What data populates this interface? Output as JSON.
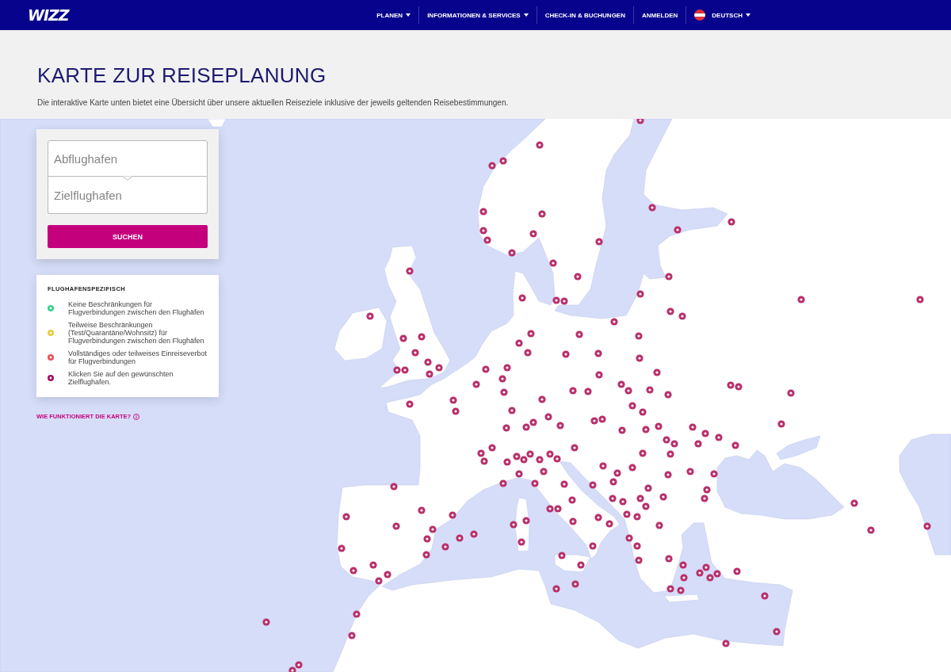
{
  "header": {
    "logo": "WIZZ",
    "nav": [
      {
        "label": "PLANEN",
        "dropdown": true
      },
      {
        "label": "INFORMATIONEN & SERVICES",
        "dropdown": true
      },
      {
        "label": "CHECK-IN & BUCHUNGEN",
        "dropdown": false
      },
      {
        "label": "ANMELDEN",
        "dropdown": false
      }
    ],
    "language": {
      "label": "DEUTSCH",
      "dropdown": true
    }
  },
  "intro": {
    "title": "KARTE ZUR REISEPLANUNG",
    "description": "Die interaktive Karte unten bietet eine Übersicht über unsere aktuellen Reiseziele inklusive der jeweils geltenden Reisebestimmungen."
  },
  "search": {
    "origin": {
      "placeholder": "Abflughafen"
    },
    "destination": {
      "placeholder": "Zielflughafen"
    },
    "button": "SUCHEN"
  },
  "legend": {
    "title": "FLUGHAFENSPEZIFISCH",
    "items": [
      {
        "text": "Keine Beschränkungen für Flugverbindungen zwischen den Flughäfen",
        "color": "#3ccf8e"
      },
      {
        "text": "Teilweise Beschränkungen (Test/Quarantäne/Wohnsitz) für Flugverbindungen zwischen den Flughäfen",
        "color": "#eccc3c"
      },
      {
        "text": "Vollständiges oder teilweises Einreiseverbot für Flugverbindungen",
        "color": "#e9505a"
      },
      {
        "text": "Klicken Sie auf den gewünschten Zielflughafen.",
        "color": "#a3105f"
      }
    ]
  },
  "help_link": "WIE FUNKTIONIERT DIE KARTE?"
}
